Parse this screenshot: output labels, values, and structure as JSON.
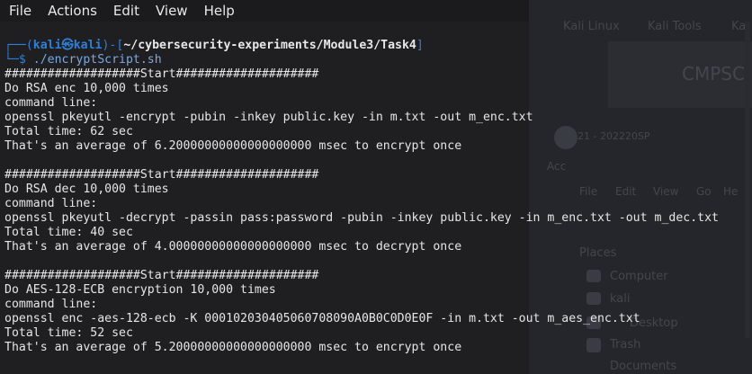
{
  "menubar": {
    "items": [
      "File",
      "Actions",
      "Edit",
      "View",
      "Help"
    ]
  },
  "background": {
    "tab1": "Kali Linux",
    "tab2": "Kali Tools",
    "tab3": "Ka",
    "course": "CMPSC",
    "semester": "2221 - 202220SP",
    "acc": "Acc",
    "fm_menu": [
      "File",
      "Edit",
      "View",
      "Go",
      "He"
    ],
    "places": "Places",
    "places_items": [
      "Computer",
      "kali",
      "Desktop",
      "Trash",
      "Documents"
    ]
  },
  "terminal": {
    "prompt": {
      "open": "┌──(",
      "user": "kali㉿kali",
      "mid": ")-[",
      "path": "~/cybersecurity-experiments/Module3/Task4",
      "close": "]",
      "line2_prefix": "└─$ ",
      "command": "./encryptScript.sh"
    },
    "lines": [
      "###################Start####################",
      "Do RSA enc 10,000 times",
      "command line:",
      "openssl pkeyutl -encrypt -pubin -inkey public.key -in m.txt -out m_enc.txt",
      "Total time: 62 sec",
      "That's an average of 6.20000000000000000000 msec to encrypt once",
      "",
      "###################Start####################",
      "Do RSA dec 10,000 times",
      "command line:",
      "openssl pkeyutl -decrypt -passin pass:password -pubin -inkey public.key -in m_enc.txt -out m_dec.txt",
      "Total time: 40 sec",
      "That's an average of 4.00000000000000000000 msec to decrypt once",
      "",
      "###################Start####################",
      "Do AES-128-ECB encryption 10,000 times",
      "command line:",
      "openssl enc -aes-128-ecb -K 000102030405060708090A0B0C0D0E0F -in m.txt -out m_aes_enc.txt",
      "Total time: 52 sec",
      "That's an average of 5.20000000000000000000 msec to encrypt once"
    ]
  }
}
